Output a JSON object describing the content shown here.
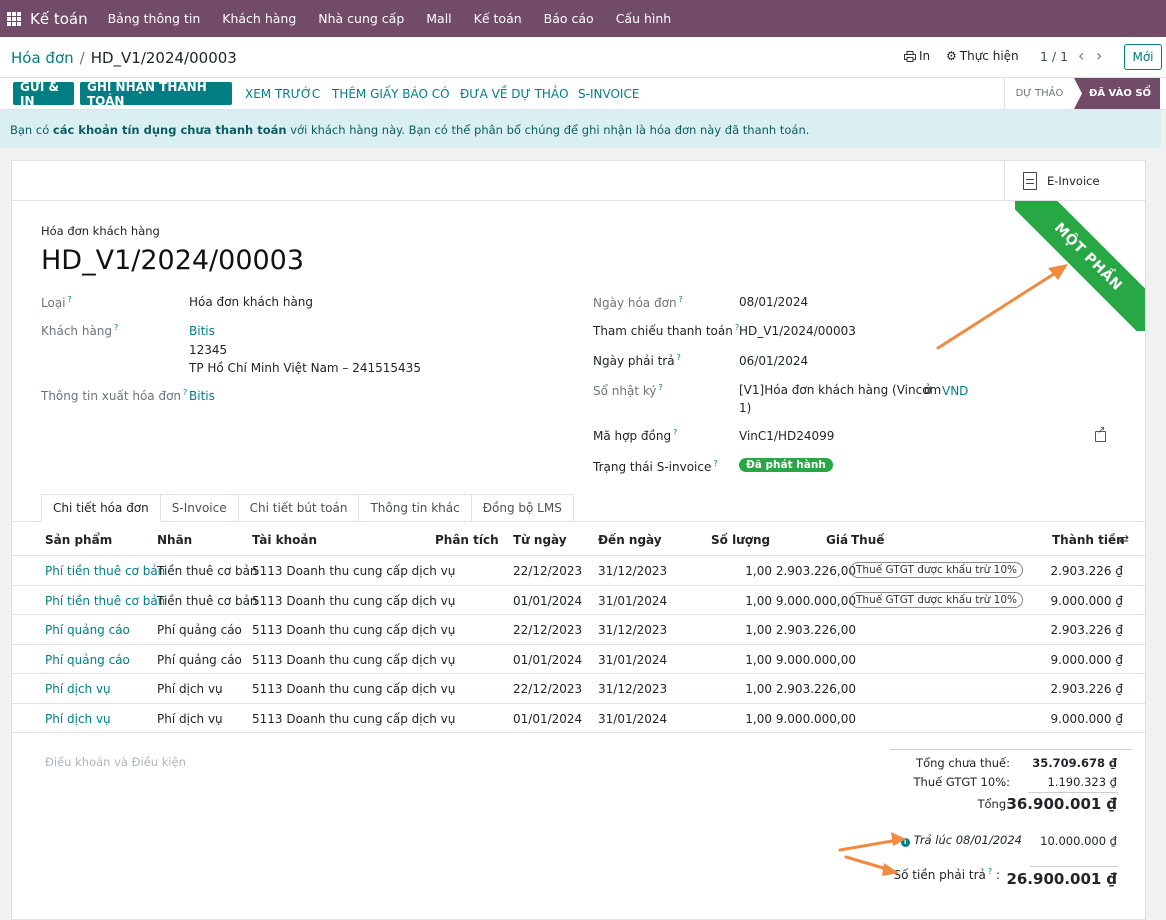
{
  "navbar": {
    "app_name": "Kế toán",
    "menu": [
      "Bảng thông tin",
      "Khách hàng",
      "Nhà cung cấp",
      "Mall",
      "Kế toán",
      "Báo cáo",
      "Cấu hình"
    ]
  },
  "control": {
    "breadcrumb_parent": "Hóa đơn",
    "breadcrumb_sep": "/",
    "breadcrumb_current": "HD_V1/2024/00003",
    "print_label": "In",
    "action_label": "Thực hiện",
    "pager": "1 / 1",
    "new_label": "Mới"
  },
  "actions": {
    "send_print": "GỬI & IN",
    "register_payment": "GHI NHẬN THANH TOÁN",
    "preview": "XEM TRƯỚC",
    "add_credit_note": "THÊM GIẤY BÁO CÓ",
    "reset_draft": "ĐƯA VỀ DỰ THẢO",
    "s_invoice": "S-INVOICE",
    "status_draft": "DỰ THẢO",
    "status_posted": "ĐÃ VÀO SỔ"
  },
  "alert": {
    "part1": "Bạn có ",
    "bold": "các khoản tín dụng chưa thanh toán",
    "part2": " với khách hàng này. Bạn có thể phân bổ chúng để ghi nhận là hóa đơn này đã thanh toán."
  },
  "sheet": {
    "einvoice_label": "E-Invoice",
    "ribbon": "MỘT PHẦN",
    "doc_type": "Hóa đơn khách hàng",
    "doc_title": "HD_V1/2024/00003",
    "left_fields": {
      "type_label": "Loại",
      "type_value": "Hóa đơn khách hàng",
      "customer_label": "Khách hàng",
      "customer_name": "Bitis",
      "customer_line2": "12345",
      "customer_line3": "TP Hồ Chí Minh Việt Nam – 241515435",
      "invoice_info_label": "Thông tin xuất hóa đơn",
      "invoice_info_value": "Bitis"
    },
    "right_fields": {
      "invoice_date_label": "Ngày hóa đơn",
      "invoice_date": "08/01/2024",
      "payment_ref_label": "Tham chiếu thanh toán",
      "payment_ref": "HD_V1/2024/00003",
      "due_date_label": "Ngày phải trả",
      "due_date": "06/01/2024",
      "journal_label": "Sổ nhật ký",
      "journal_line1": "[V1]Hóa đơn khách hàng (Vincom",
      "journal_line2": "1)",
      "journal_in": "ở",
      "currency": "VND",
      "contract_label": "Mã hợp đồng",
      "contract": "VinC1/HD24099",
      "sinvoice_status_label": "Trạng thái S-invoice",
      "sinvoice_status": "Đã phát hành"
    },
    "tabs": [
      "Chi tiết hóa đơn",
      "S-Invoice",
      "Chi tiết bút toán",
      "Thông tin khác",
      "Đồng bộ LMS"
    ]
  },
  "table": {
    "headers": {
      "product": "Sản phẩm",
      "label": "Nhãn",
      "account": "Tài khoản",
      "analytic": "Phân tích",
      "from": "Từ ngày",
      "to": "Đến ngày",
      "qty": "Số lượng",
      "price": "Giá",
      "tax": "Thuế",
      "subtotal": "Thành tiền"
    },
    "rows": [
      {
        "product": "Phí tiền thuê cơ bản",
        "label": "Tiền thuê cơ bản",
        "account": "5113 Doanh thu cung cấp dịch vụ",
        "from": "22/12/2023",
        "to": "31/12/2023",
        "qty": "1,00",
        "price": "2.903.226,00",
        "tax": "Thuế GTGT được khấu trừ 10%",
        "subtotal": "2.903.226 ₫"
      },
      {
        "product": "Phí tiền thuê cơ bản",
        "label": "Tiền thuê cơ bản",
        "account": "5113 Doanh thu cung cấp dịch vụ",
        "from": "01/01/2024",
        "to": "31/01/2024",
        "qty": "1,00",
        "price": "9.000.000,00",
        "tax": "Thuế GTGT được khấu trừ 10%",
        "subtotal": "9.000.000 ₫"
      },
      {
        "product": "Phí quảng cáo",
        "label": "Phí quảng cáo",
        "account": "5113 Doanh thu cung cấp dịch vụ",
        "from": "22/12/2023",
        "to": "31/12/2023",
        "qty": "1,00",
        "price": "2.903.226,00",
        "tax": "",
        "subtotal": "2.903.226 ₫"
      },
      {
        "product": "Phí quảng cáo",
        "label": "Phí quảng cáo",
        "account": "5113 Doanh thu cung cấp dịch vụ",
        "from": "01/01/2024",
        "to": "31/01/2024",
        "qty": "1,00",
        "price": "9.000.000,00",
        "tax": "",
        "subtotal": "9.000.000 ₫"
      },
      {
        "product": "Phí dịch vụ",
        "label": "Phí dịch vụ",
        "account": "5113 Doanh thu cung cấp dịch vụ",
        "from": "22/12/2023",
        "to": "31/12/2023",
        "qty": "1,00",
        "price": "2.903.226,00",
        "tax": "",
        "subtotal": "2.903.226 ₫"
      },
      {
        "product": "Phí dịch vụ",
        "label": "Phí dịch vụ",
        "account": "5113 Doanh thu cung cấp dịch vụ",
        "from": "01/01/2024",
        "to": "31/01/2024",
        "qty": "1,00",
        "price": "9.000.000,00",
        "tax": "",
        "subtotal": "9.000.000 ₫"
      }
    ]
  },
  "totals": {
    "terms_placeholder": "Điều khoản và Điều kiện",
    "untaxed_label": "Tổng chưa thuế:",
    "untaxed": "35.709.678 ₫",
    "vat_label": "Thuế GTGT 10%:",
    "vat": "1.190.323 ₫",
    "total_label": "Tổng:",
    "total": "36.900.001 ₫",
    "paid_label": "Trả lúc 08/01/2024",
    "paid": "10.000.000 ₫",
    "due_label": "Số tiền phải trả",
    "due_colon": ":",
    "due": "26.900.001 ₫"
  },
  "colors": {
    "brand": "#714b67",
    "accent": "#017e84",
    "ribbon": "#28a745",
    "annotation_arrow": "#f08a3c"
  }
}
